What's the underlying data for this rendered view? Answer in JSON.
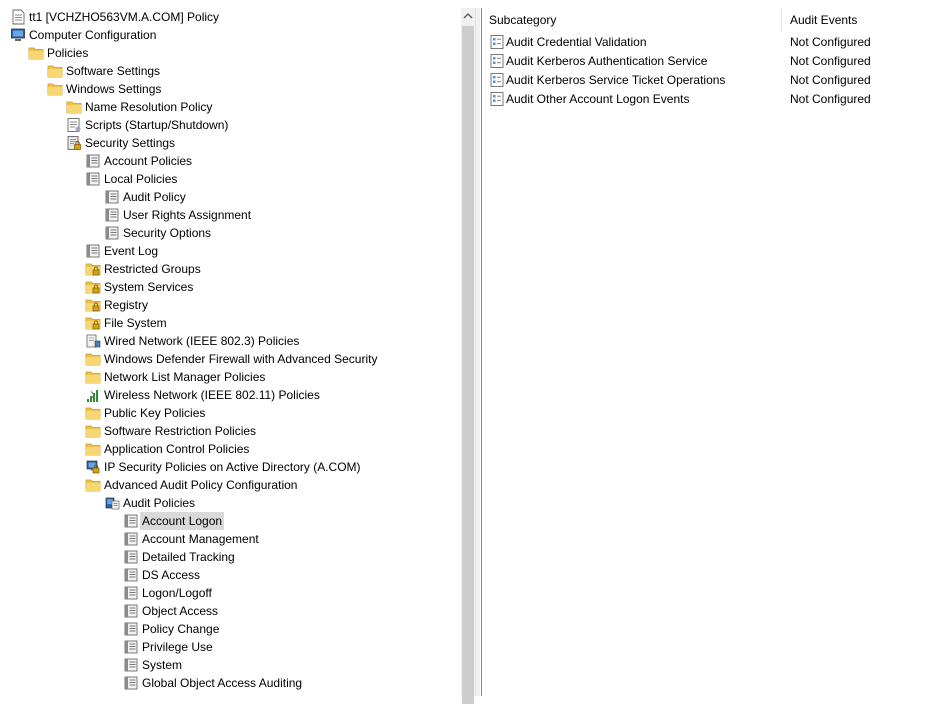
{
  "tree": [
    {
      "label": "tt1 [VCHZHO563VM.A.COM] Policy",
      "level": 0,
      "toggle": "none",
      "icon": "policy-doc-icon"
    },
    {
      "label": "Computer Configuration",
      "level": 0,
      "toggle": "expanded",
      "icon": "computer-icon"
    },
    {
      "label": "Policies",
      "level": 1,
      "toggle": "expanded",
      "icon": "folder-icon"
    },
    {
      "label": "Software Settings",
      "level": 2,
      "toggle": "collapsed",
      "icon": "folder-icon"
    },
    {
      "label": "Windows Settings",
      "level": 2,
      "toggle": "expanded",
      "icon": "folder-icon"
    },
    {
      "label": "Name Resolution Policy",
      "level": 3,
      "toggle": "collapsed",
      "icon": "folder-icon"
    },
    {
      "label": "Scripts (Startup/Shutdown)",
      "level": 3,
      "toggle": "none",
      "icon": "script-icon"
    },
    {
      "label": "Security Settings",
      "level": 3,
      "toggle": "expanded",
      "icon": "security-settings-icon"
    },
    {
      "label": "Account Policies",
      "level": 4,
      "toggle": "collapsed",
      "icon": "policy-book-icon"
    },
    {
      "label": "Local Policies",
      "level": 4,
      "toggle": "expanded",
      "icon": "policy-book-icon"
    },
    {
      "label": "Audit Policy",
      "level": 5,
      "toggle": "none",
      "icon": "policy-book-icon"
    },
    {
      "label": "User Rights Assignment",
      "level": 5,
      "toggle": "collapsed",
      "icon": "policy-book-icon"
    },
    {
      "label": "Security Options",
      "level": 5,
      "toggle": "collapsed",
      "icon": "policy-book-icon"
    },
    {
      "label": "Event Log",
      "level": 4,
      "toggle": "collapsed",
      "icon": "policy-book-icon"
    },
    {
      "label": "Restricted Groups",
      "level": 4,
      "toggle": "collapsed",
      "icon": "locked-folder-icon"
    },
    {
      "label": "System Services",
      "level": 4,
      "toggle": "collapsed",
      "icon": "locked-folder-icon"
    },
    {
      "label": "Registry",
      "level": 4,
      "toggle": "collapsed",
      "icon": "locked-folder-icon"
    },
    {
      "label": "File System",
      "level": 4,
      "toggle": "collapsed",
      "icon": "locked-folder-icon"
    },
    {
      "label": "Wired Network (IEEE 802.3) Policies",
      "level": 4,
      "toggle": "collapsed",
      "icon": "wired-network-icon"
    },
    {
      "label": "Windows Defender Firewall with Advanced Security",
      "level": 4,
      "toggle": "collapsed",
      "icon": "folder-icon"
    },
    {
      "label": "Network List Manager Policies",
      "level": 4,
      "toggle": "none",
      "icon": "folder-icon"
    },
    {
      "label": "Wireless Network (IEEE 802.11) Policies",
      "level": 4,
      "toggle": "collapsed",
      "icon": "wireless-network-icon"
    },
    {
      "label": "Public Key Policies",
      "level": 4,
      "toggle": "collapsed",
      "icon": "folder-icon"
    },
    {
      "label": "Software Restriction Policies",
      "level": 4,
      "toggle": "collapsed",
      "icon": "folder-icon"
    },
    {
      "label": "Application Control Policies",
      "level": 4,
      "toggle": "collapsed",
      "icon": "folder-icon"
    },
    {
      "label": "IP Security Policies on Active Directory (A.COM)",
      "level": 4,
      "toggle": "collapsed",
      "icon": "ipsec-icon"
    },
    {
      "label": "Advanced Audit Policy Configuration",
      "level": 4,
      "toggle": "expanded",
      "icon": "folder-icon"
    },
    {
      "label": "Audit Policies",
      "level": 5,
      "toggle": "expanded",
      "icon": "audit-policies-icon"
    },
    {
      "label": "Account Logon",
      "level": 6,
      "toggle": "none",
      "icon": "policy-book-icon",
      "selected": true
    },
    {
      "label": "Account Management",
      "level": 6,
      "toggle": "collapsed",
      "icon": "policy-book-icon"
    },
    {
      "label": "Detailed Tracking",
      "level": 6,
      "toggle": "collapsed",
      "icon": "policy-book-icon"
    },
    {
      "label": "DS Access",
      "level": 6,
      "toggle": "collapsed",
      "icon": "policy-book-icon"
    },
    {
      "label": "Logon/Logoff",
      "level": 6,
      "toggle": "collapsed",
      "icon": "policy-book-icon"
    },
    {
      "label": "Object Access",
      "level": 6,
      "toggle": "collapsed",
      "icon": "policy-book-icon"
    },
    {
      "label": "Policy Change",
      "level": 6,
      "toggle": "collapsed",
      "icon": "policy-book-icon"
    },
    {
      "label": "Privilege Use",
      "level": 6,
      "toggle": "collapsed",
      "icon": "policy-book-icon"
    },
    {
      "label": "System",
      "level": 6,
      "toggle": "collapsed",
      "icon": "policy-book-icon"
    },
    {
      "label": "Global Object Access Auditing",
      "level": 6,
      "toggle": "collapsed",
      "icon": "policy-book-icon"
    }
  ],
  "list": {
    "columns": {
      "subcategory": "Subcategory",
      "audit_events": "Audit Events"
    },
    "rows": [
      {
        "subcategory": "Audit Credential Validation",
        "audit_events": "Not Configured",
        "icon": "audit-setting-icon"
      },
      {
        "subcategory": "Audit Kerberos Authentication Service",
        "audit_events": "Not Configured",
        "icon": "audit-setting-icon"
      },
      {
        "subcategory": "Audit Kerberos Service Ticket Operations",
        "audit_events": "Not Configured",
        "icon": "audit-setting-icon"
      },
      {
        "subcategory": "Audit Other Account Logon Events",
        "audit_events": "Not Configured",
        "icon": "audit-setting-icon"
      }
    ]
  },
  "colors": {
    "folder": "#f0c24b",
    "selected_row": "#d9d9d9",
    "scroll_thumb": "#cdcdcd"
  }
}
